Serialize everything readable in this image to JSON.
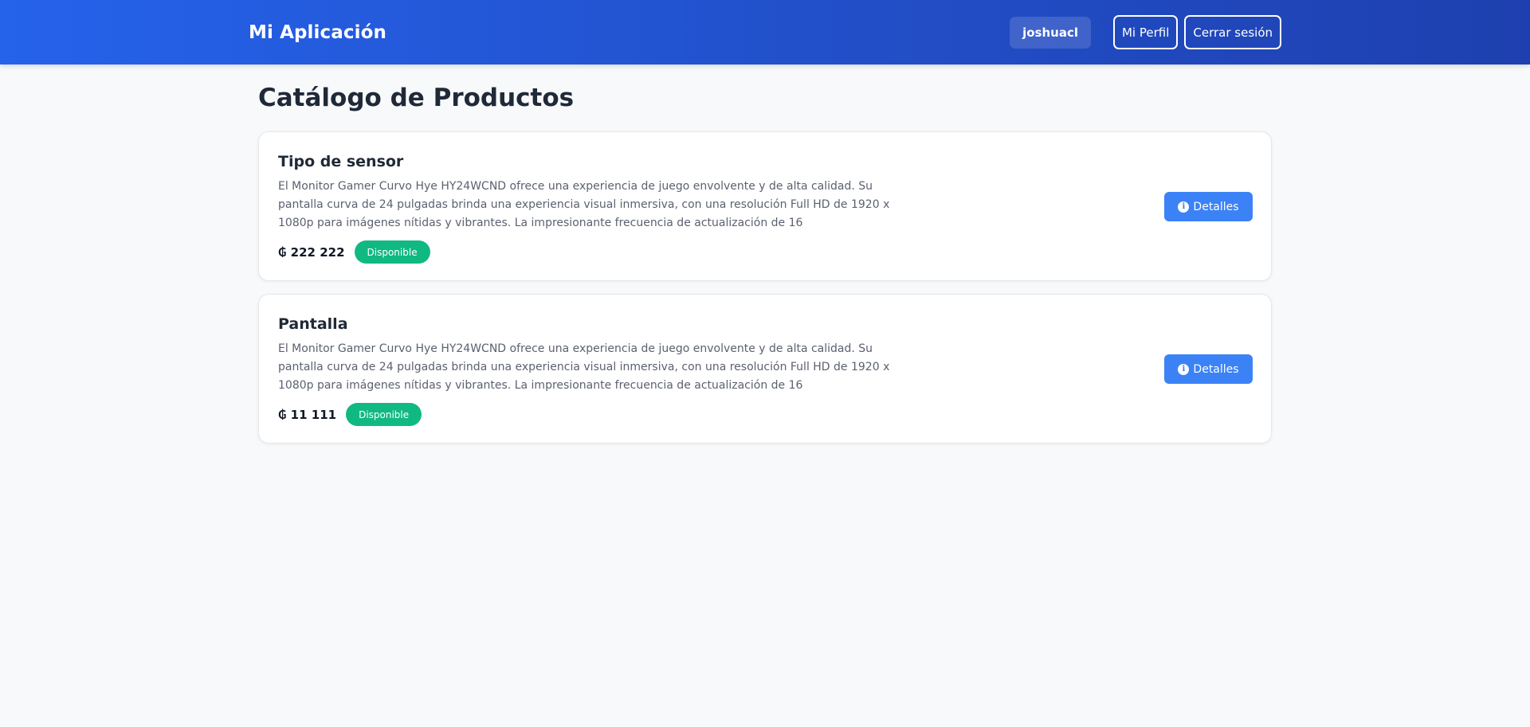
{
  "navbar": {
    "brand": "Mi Aplicación",
    "username": "joshuacl",
    "profile_label": "Mi Perfil",
    "logout_label": "Cerrar sesión"
  },
  "page": {
    "title": "Catálogo de Productos"
  },
  "products": [
    {
      "name": "Tipo de sensor",
      "description": "El Monitor Gamer Curvo Hye HY24WCND ofrece una experiencia de juego envolvente y de alta calidad. Su pantalla curva de 24 pulgadas brinda una experiencia visual inmersiva, con una resolución Full HD de 1920 x 1080p para imágenes nítidas y vibrantes. La impresionante frecuencia de actualización de 16",
      "price": "₲ 222 222",
      "status": "Disponible",
      "details_label": "Detalles"
    },
    {
      "name": "Pantalla",
      "description": "El Monitor Gamer Curvo Hye HY24WCND ofrece una experiencia de juego envolvente y de alta calidad. Su pantalla curva de 24 pulgadas brinda una experiencia visual inmersiva, con una resolución Full HD de 1920 x 1080p para imágenes nítidas y vibrantes. La impresionante frecuencia de actualización de 16",
      "price": "₲ 11 111",
      "status": "Disponible",
      "details_label": "Detalles"
    }
  ],
  "icons": {
    "details": "info-circle-icon"
  },
  "colors": {
    "navbar_start": "#2563eb",
    "navbar_end": "#1e40af",
    "badge_available": "#10b981",
    "details_button": "#3b82f6",
    "page_background": "#f8f9fb"
  }
}
